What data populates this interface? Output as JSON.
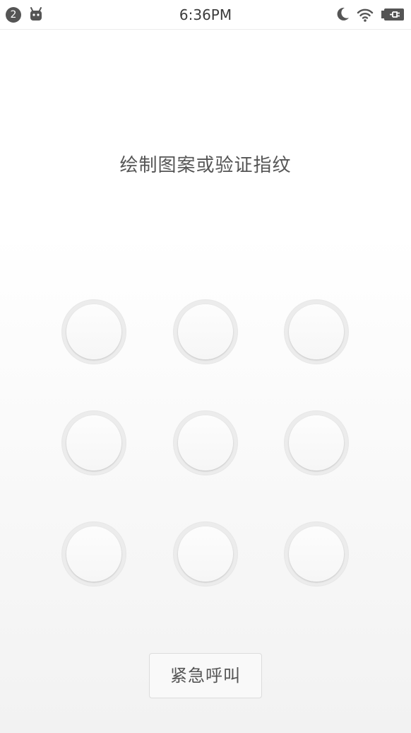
{
  "status_bar": {
    "notification_count": "2",
    "time": "6:36PM",
    "icons": [
      "android-robot-icon",
      "moon-icon",
      "wifi-icon",
      "battery-charging-icon"
    ]
  },
  "lock_screen": {
    "prompt": "绘制图案或验证指纹",
    "pattern_grid": {
      "rows": 3,
      "cols": 3
    },
    "emergency_call_label": "紧急呼叫"
  },
  "colors": {
    "text": "#555555",
    "dot_ring": "#ececec",
    "background_bottom": "#f2f2f2"
  }
}
